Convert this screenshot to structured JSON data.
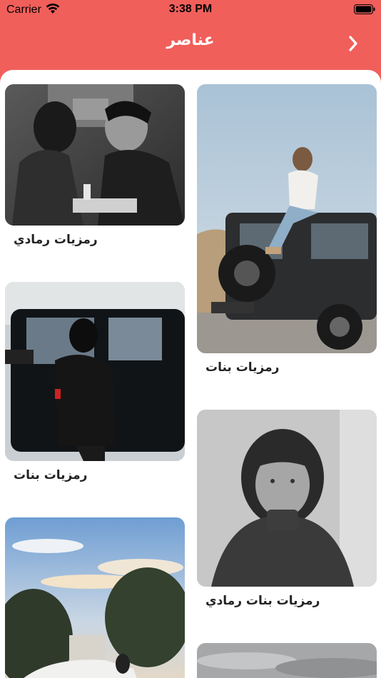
{
  "status_bar": {
    "carrier": "Carrier",
    "time": "3:38 PM"
  },
  "nav": {
    "title": "عناصر",
    "back_icon": "chevron-right-icon"
  },
  "colors": {
    "header": "#f15f5b",
    "content_bg": "#ffffff",
    "label_text": "#222222"
  },
  "cards": [
    {
      "id": "card-1",
      "label": "رمزيات رمادي",
      "image": "grayscale couple photo"
    },
    {
      "id": "card-2",
      "label": "رمزيات بنات",
      "image": "girl sitting on jeep"
    },
    {
      "id": "card-3",
      "label": "رمزيات بنات",
      "image": "girl beside black car"
    },
    {
      "id": "card-4",
      "label": "رمزيات بنات رمادي",
      "image": "grayscale girl portrait"
    },
    {
      "id": "card-5",
      "label": "",
      "image": "sky with trees and white car"
    },
    {
      "id": "card-6",
      "label": "",
      "image": "cloudy sky"
    }
  ]
}
